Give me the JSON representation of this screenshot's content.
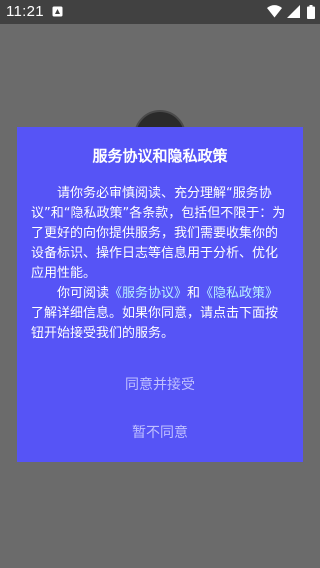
{
  "status_bar": {
    "time": "11:21",
    "icons": [
      "notification-icon",
      "wifi-icon",
      "signal-icon",
      "battery-icon"
    ]
  },
  "dialog": {
    "title": "服务协议和隐私政策",
    "para1": "请你务必审慎阅读、充分理解“服务协议”和“隐私政策”各条款，包括但不限于：为了更好的向你提供服务，我们需要收集你的设备标识、操作日志等信息用于分析、优化应用性能。",
    "para2_prefix": "你可阅读",
    "service_link": "《服务协议》",
    "para2_and": "和",
    "privacy_link": "《隐私政策》",
    "para2_suffix": "了解详细信息。如果你同意，请点击下面按钮开始接受我们的服务。",
    "accept_label": "同意并接受",
    "decline_label": "暂不同意"
  },
  "colors": {
    "dialog_bg": "#5654f6",
    "link": "#b9f0ff",
    "button_text": "#bfbfff",
    "overlay": "#6b6b6b",
    "status_bar": "#414141"
  }
}
